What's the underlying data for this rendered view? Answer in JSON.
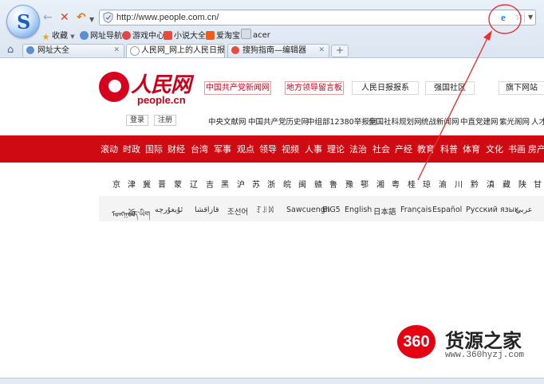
{
  "browser": {
    "address_url": "http://www.people.com.cn/",
    "bookmarks": [
      "收藏",
      "网址导航",
      "游戏中心",
      "小说大全",
      "爱淘宝",
      "acer"
    ],
    "tabs": [
      {
        "label": "网址大全",
        "active": false
      },
      {
        "label": "人民网_网上的人民日报",
        "active": true
      },
      {
        "label": "搜狗指南—编辑器",
        "active": false
      }
    ],
    "new_tab": "+"
  },
  "site": {
    "logo_cn": "人民网",
    "logo_en": "people.cn",
    "top_links": [
      "中国共产党新闻网",
      "地方领导留言板",
      "人民日报报系",
      "强国社区",
      "旗下网站"
    ],
    "login": "登录",
    "register": "注册",
    "channel_links": [
      "中央文献网",
      "中国共产党历史网",
      "中组部12380举报网",
      "全国社科规划网",
      "统战新闻网",
      "中直党建网",
      "紫光阁网",
      "人才"
    ],
    "nav": [
      "滚动",
      "时政",
      "国际",
      "财经",
      "台湾",
      "军事",
      "观点",
      "领导",
      "视频",
      "人事",
      "理论",
      "法治",
      "社会",
      "产经",
      "教育",
      "科普",
      "体育",
      "文化",
      "书画",
      "房产"
    ],
    "regions": [
      "京",
      "津",
      "冀",
      "晋",
      "蒙",
      "辽",
      "吉",
      "黑",
      "沪",
      "苏",
      "浙",
      "皖",
      "闽",
      "赣",
      "鲁",
      "豫",
      "鄂",
      "湘",
      "粤",
      "桂",
      "琼",
      "渝",
      "川",
      "黔",
      "滇",
      "藏",
      "陕",
      "甘"
    ],
    "languages": [
      "ᠮᠣᠩᠭᠣᠯ",
      "བོད་ཡིག",
      "ئۇيغۇرچە",
      "قازاقشا",
      "조선어",
      "ꆈꌠꉙ",
      "Sawcuengh",
      "BIG5",
      "English",
      "日本語",
      "Français",
      "Español",
      "Русский язык",
      "عربي"
    ]
  },
  "watermark": {
    "badge": "360",
    "cn": "货源之家",
    "url": "www.360hyzj.com"
  },
  "colors": {
    "brand_red": "#d00a12",
    "annotation_red": "#e8322f"
  }
}
